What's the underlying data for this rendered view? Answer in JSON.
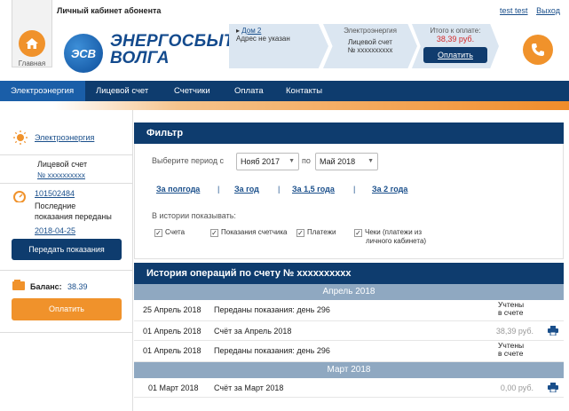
{
  "header": {
    "cabinet_title": "Личный кабинет абонента",
    "home_label": "Главная",
    "user_link": "test test",
    "logout_link": "Выход",
    "logo_badge": "ЭСВ",
    "logo_line1": "ЭНЕРГОСБЫТ",
    "logo_line2": "ВОЛГА",
    "house_link": "Дом 2",
    "address": "Адрес не указан",
    "service": "Электроэнергия",
    "account_label": "Лицевой счет",
    "account_no": "№  xxxxxxxxxx",
    "total_label": "Итого к оплате:",
    "total_amount": "38,39 руб.",
    "pay_button": "Оплатить"
  },
  "nav": {
    "items": [
      {
        "label": "Электроэнергия"
      },
      {
        "label": "Лицевой счет"
      },
      {
        "label": "Счетчики"
      },
      {
        "label": "Оплата"
      },
      {
        "label": "Контакты"
      }
    ]
  },
  "sidebar": {
    "service_link": "Электроэнергия",
    "account_label": "Лицевой счет",
    "account_no": "№  xxxxxxxxxx",
    "meter_link": "101502484",
    "last_readings_line1": "Последние",
    "last_readings_line2": "показания переданы",
    "readings_date": "2018-04-25",
    "submit_readings": "Передать показания",
    "balance_label": "Баланс:",
    "balance_value": "38.39",
    "pay_button": "Оплатить"
  },
  "filter": {
    "title": "Фильтр",
    "period_label": "Выберите период с",
    "from_value": "Нояб 2017",
    "to_label": "по",
    "to_value": "Май 2018",
    "quick_links": [
      "За полгода",
      "За год",
      "За 1,5 года",
      "За 2 года"
    ],
    "show_label": "В истории показывать:",
    "checkboxes": [
      {
        "label": "Счета",
        "checked": true
      },
      {
        "label": "Показания счетчика",
        "checked": true
      },
      {
        "label": "Платежи",
        "checked": true
      },
      {
        "label_line1": "Чеки (платежи из",
        "label_line2": "личного кабинета)",
        "checked": true
      }
    ]
  },
  "history": {
    "title": "История операций по счету №  xxxxxxxxxx",
    "groups": [
      {
        "month": "Апрель 2018",
        "rows": [
          {
            "date": "25 Апрель 2018",
            "desc": "Переданы показания: день 296",
            "status_line1": "Учтены",
            "status_line2": "в счете"
          },
          {
            "date": "01 Апрель 2018",
            "desc": "Счёт за Апрель 2018",
            "amount": "38,39 руб."
          },
          {
            "date": "01 Апрель 2018",
            "desc": "Переданы показания: день 296",
            "status_line1": "Учтены",
            "status_line2": "в счете"
          }
        ]
      },
      {
        "month": "Март 2018",
        "rows": [
          {
            "date": "01 Март 2018",
            "desc": "Счёт за Март 2018",
            "amount": "0,00 руб."
          }
        ]
      }
    ]
  },
  "colors": {
    "navy": "#0e3c6e",
    "orange": "#f0922b",
    "month_bar": "#8fa8c1",
    "amount_red": "#d42a2a"
  }
}
